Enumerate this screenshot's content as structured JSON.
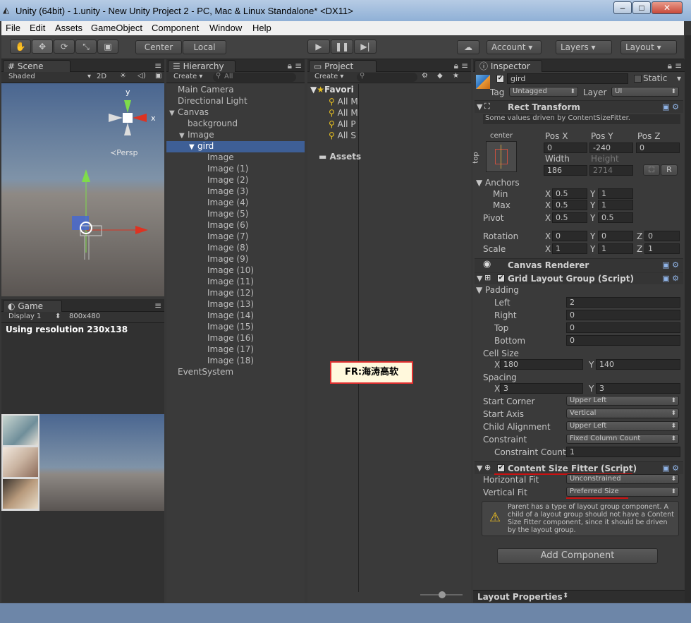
{
  "window": {
    "title": "Unity (64bit) - 1.unity - New Unity Project 2 - PC, Mac & Linux Standalone* <DX11>",
    "min": "‒",
    "max": "□",
    "close": "✕"
  },
  "menu": [
    "File",
    "Edit",
    "Assets",
    "GameObject",
    "Component",
    "Window",
    "Help"
  ],
  "toolbar": {
    "center": "Center",
    "local": "Local",
    "account": "Account",
    "layers": "Layers",
    "layout": "Layout"
  },
  "scene": {
    "tab": "Scene",
    "shading": "Shaded",
    "mode2d": "2D",
    "persp": "Persp",
    "gizmo_x": "x",
    "gizmo_y": "y"
  },
  "game": {
    "tab": "Game",
    "display": "Display 1",
    "resolution": "800x480",
    "using_resolution": "Using resolution 230x138"
  },
  "hierarchy": {
    "tab": "Hierarchy",
    "create": "Create",
    "search": "All",
    "items": [
      {
        "label": "Main Camera",
        "indent": 0,
        "arrow": ""
      },
      {
        "label": "Directional Light",
        "indent": 0,
        "arrow": ""
      },
      {
        "label": "Canvas",
        "indent": 0,
        "arrow": "▼"
      },
      {
        "label": "background",
        "indent": 1,
        "arrow": ""
      },
      {
        "label": "Image",
        "indent": 1,
        "arrow": "▼"
      },
      {
        "label": "gird",
        "indent": 2,
        "arrow": "▼",
        "selected": true
      },
      {
        "label": "Image",
        "indent": 3,
        "arrow": ""
      },
      {
        "label": "Image (1)",
        "indent": 3,
        "arrow": ""
      },
      {
        "label": "Image (2)",
        "indent": 3,
        "arrow": ""
      },
      {
        "label": "Image (3)",
        "indent": 3,
        "arrow": ""
      },
      {
        "label": "Image (4)",
        "indent": 3,
        "arrow": ""
      },
      {
        "label": "Image (5)",
        "indent": 3,
        "arrow": ""
      },
      {
        "label": "Image (6)",
        "indent": 3,
        "arrow": ""
      },
      {
        "label": "Image (7)",
        "indent": 3,
        "arrow": ""
      },
      {
        "label": "Image (8)",
        "indent": 3,
        "arrow": ""
      },
      {
        "label": "Image (9)",
        "indent": 3,
        "arrow": ""
      },
      {
        "label": "Image (10)",
        "indent": 3,
        "arrow": ""
      },
      {
        "label": "Image (11)",
        "indent": 3,
        "arrow": ""
      },
      {
        "label": "Image (12)",
        "indent": 3,
        "arrow": ""
      },
      {
        "label": "Image (13)",
        "indent": 3,
        "arrow": ""
      },
      {
        "label": "Image (14)",
        "indent": 3,
        "arrow": ""
      },
      {
        "label": "Image (15)",
        "indent": 3,
        "arrow": ""
      },
      {
        "label": "Image (16)",
        "indent": 3,
        "arrow": ""
      },
      {
        "label": "Image (17)",
        "indent": 3,
        "arrow": ""
      },
      {
        "label": "Image (18)",
        "indent": 3,
        "arrow": ""
      },
      {
        "label": "EventSystem",
        "indent": 0,
        "arrow": ""
      }
    ]
  },
  "project": {
    "tab": "Project",
    "create": "Create",
    "favorites": "Favori",
    "fav_items": [
      "All M",
      "All M",
      "All P",
      "All S"
    ],
    "assets": "Assets"
  },
  "watermark": "FR:海涛高软",
  "inspector": {
    "tab": "Inspector",
    "object_name": "gird",
    "static": "Static",
    "tag_label": "Tag",
    "tag": "Untagged",
    "layer_label": "Layer",
    "layer": "UI",
    "rect": {
      "title": "Rect Transform",
      "note": "Some values driven by ContentSizeFitter.",
      "anchor_h": "center",
      "anchor_v": "top",
      "posx_l": "Pos X",
      "posy_l": "Pos Y",
      "posz_l": "Pos Z",
      "posx": "0",
      "posy": "-240",
      "posz": "0",
      "width_l": "Width",
      "height_l": "Height",
      "width": "186",
      "height": "2714",
      "r": "R",
      "anchors": "Anchors",
      "min": "Min",
      "max": "Max",
      "min_x": "0.5",
      "min_y": "1",
      "max_x": "0.5",
      "max_y": "1",
      "pivot": "Pivot",
      "pivot_x": "0.5",
      "pivot_y": "0.5",
      "rotation": "Rotation",
      "rot_x": "0",
      "rot_y": "0",
      "rot_z": "0",
      "scale": "Scale",
      "sc_x": "1",
      "sc_y": "1",
      "sc_z": "1",
      "xl": "X",
      "yl": "Y",
      "zl": "Z"
    },
    "canvas_renderer": "Canvas Renderer",
    "grid": {
      "title": "Grid Layout Group (Script)",
      "padding": "Padding",
      "left_l": "Left",
      "left": "2",
      "right_l": "Right",
      "right": "0",
      "top_l": "Top",
      "top": "0",
      "bottom_l": "Bottom",
      "bottom": "0",
      "cell_size": "Cell Size",
      "cell_x": "180",
      "cell_y": "140",
      "spacing": "Spacing",
      "sp_x": "3",
      "sp_y": "3",
      "start_corner_l": "Start Corner",
      "start_corner": "Upper Left",
      "start_axis_l": "Start Axis",
      "start_axis": "Vertical",
      "child_align_l": "Child Alignment",
      "child_align": "Upper Left",
      "constraint_l": "Constraint",
      "constraint": "Fixed Column Count",
      "constraint_count_l": "Constraint Count",
      "constraint_count": "1"
    },
    "csf": {
      "title": "Content Size Fitter (Script)",
      "hfit_l": "Horizontal Fit",
      "hfit": "Unconstrained",
      "vfit_l": "Vertical Fit",
      "vfit": "Preferred Size",
      "warning": "Parent has a type of layout group component. A child of a layout group should not have a Content Size Fitter component, since it should be driven by the layout group."
    },
    "add_component": "Add Component",
    "layout_props": "Layout Properties"
  },
  "colors": {
    "selection": "#3e5f96",
    "accent_red": "#cc1111",
    "watermark_border": "#e03030"
  }
}
